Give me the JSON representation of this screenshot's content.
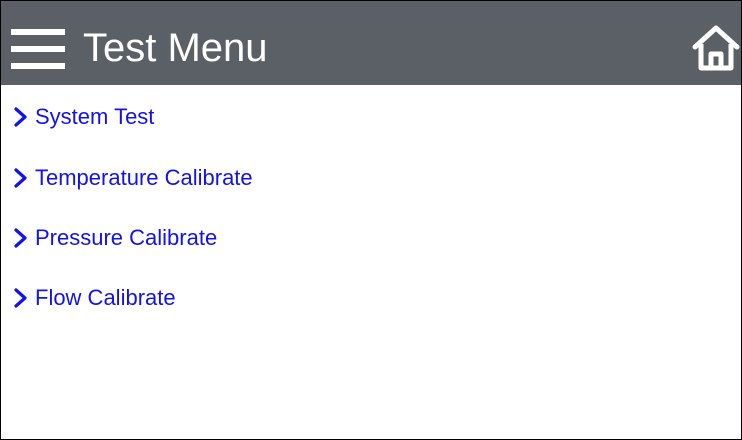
{
  "header": {
    "title": "Test Menu",
    "menu_icon": "hamburger-menu-icon",
    "home_icon": "home-icon",
    "background_color": "#5a6065",
    "text_color": "#ffffff"
  },
  "menu": {
    "item_color": "#1212ee",
    "items": [
      {
        "label": "System Test",
        "icon": "chevron-right-icon"
      },
      {
        "label": "Temperature Calibrate",
        "icon": "chevron-right-icon"
      },
      {
        "label": "Pressure Calibrate",
        "icon": "chevron-right-icon"
      },
      {
        "label": "Flow Calibrate",
        "icon": "chevron-right-icon"
      }
    ]
  }
}
